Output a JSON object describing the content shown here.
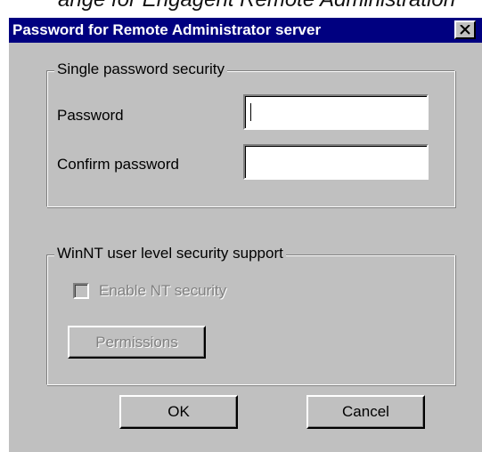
{
  "caption": "ange for Engagent Remote Administration",
  "window": {
    "title": "Password for Remote Administrator server",
    "close_icon": "close-x-icon"
  },
  "single_password_group": {
    "legend": "Single password security",
    "password_label": "Password",
    "password_value": "",
    "confirm_label": "Confirm password",
    "confirm_value": ""
  },
  "nt_security_group": {
    "legend": "WinNT user level security support",
    "enable_checkbox_label": "Enable NT security",
    "enable_checked": false,
    "enable_disabled": true,
    "permissions_button": "Permissions",
    "permissions_disabled": true
  },
  "footer": {
    "ok_button": "OK",
    "cancel_button": "Cancel"
  },
  "colors": {
    "titlebar": "#000080",
    "face": "#c0c0c0",
    "disabled_text": "#808080"
  }
}
